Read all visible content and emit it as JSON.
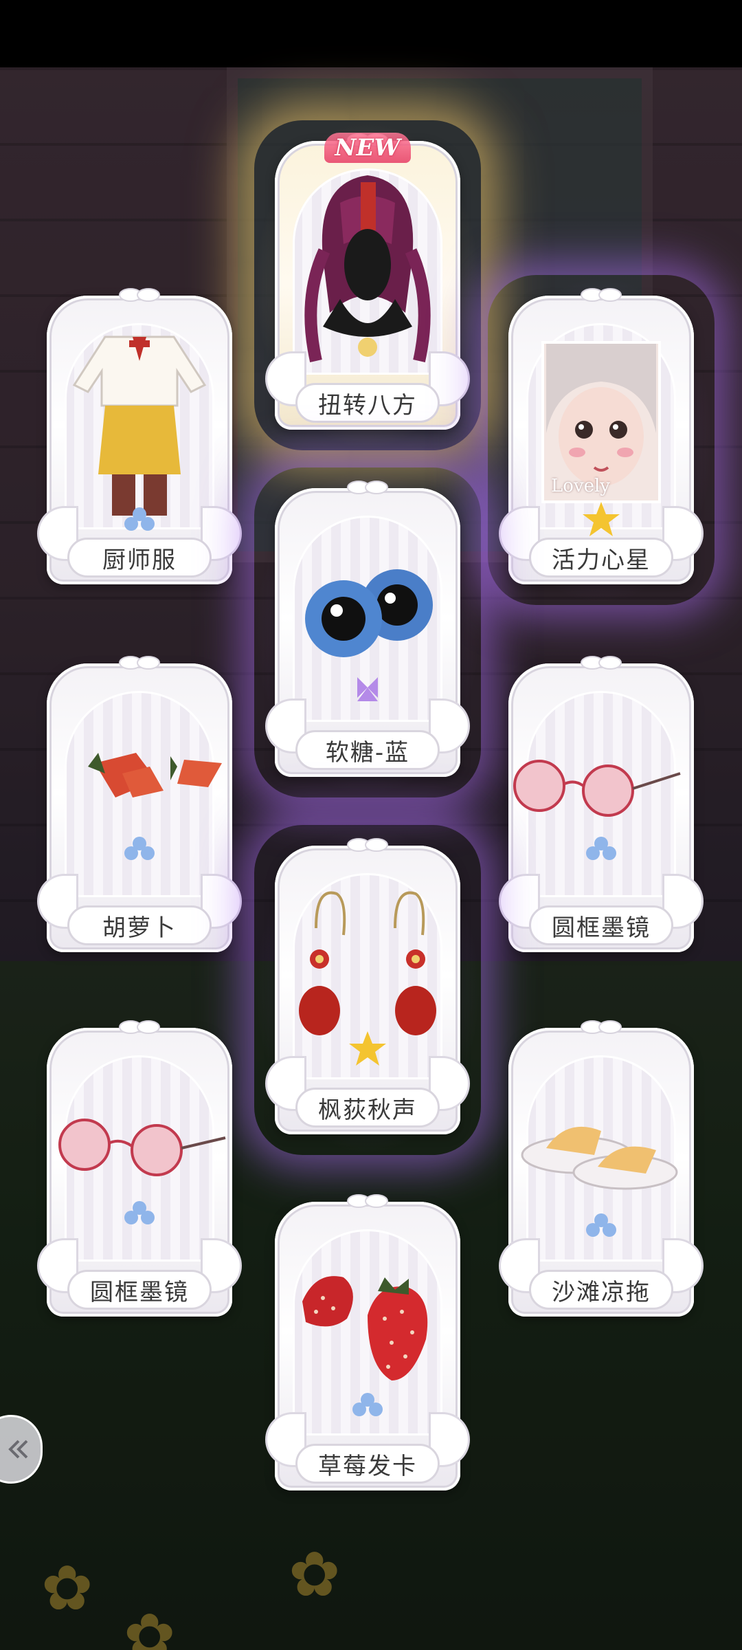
{
  "cards": [
    {
      "name": "扭转八方",
      "badge": "NEW",
      "gem_color": "#f4d05a",
      "glow": "gold",
      "item": "hair-icon"
    },
    {
      "name": "厨师服",
      "gem_color": "#8fb5ea",
      "glow": "none",
      "item": "chef-outfit-icon"
    },
    {
      "name": "活力心星",
      "gem_color": "#f4c430",
      "glow": "purple",
      "item": "makeup-portrait-icon",
      "portrait_caption": "Lovely"
    },
    {
      "name": "软糖-蓝",
      "gem_color": "#b48ae8",
      "glow": "purple",
      "item": "blue-eyes-icon"
    },
    {
      "name": "胡萝卜",
      "gem_color": "#8fb5ea",
      "glow": "none",
      "item": "carrot-clips-icon"
    },
    {
      "name": "圆框墨镜",
      "gem_color": "#8fb5ea",
      "glow": "none",
      "item": "round-glasses-icon"
    },
    {
      "name": "枫荻秋声",
      "gem_color": "#f4c430",
      "glow": "purple",
      "item": "earrings-icon"
    },
    {
      "name": "圆框墨镜",
      "gem_color": "#8fb5ea",
      "glow": "none",
      "item": "round-glasses-icon"
    },
    {
      "name": "沙滩凉拖",
      "gem_color": "#8fb5ea",
      "glow": "none",
      "item": "slippers-icon"
    },
    {
      "name": "草莓发卡",
      "gem_color": "#8fb5ea",
      "glow": "none",
      "item": "strawberry-clips-icon"
    }
  ],
  "back_button": {
    "icon": "double-chevron-left-icon"
  }
}
